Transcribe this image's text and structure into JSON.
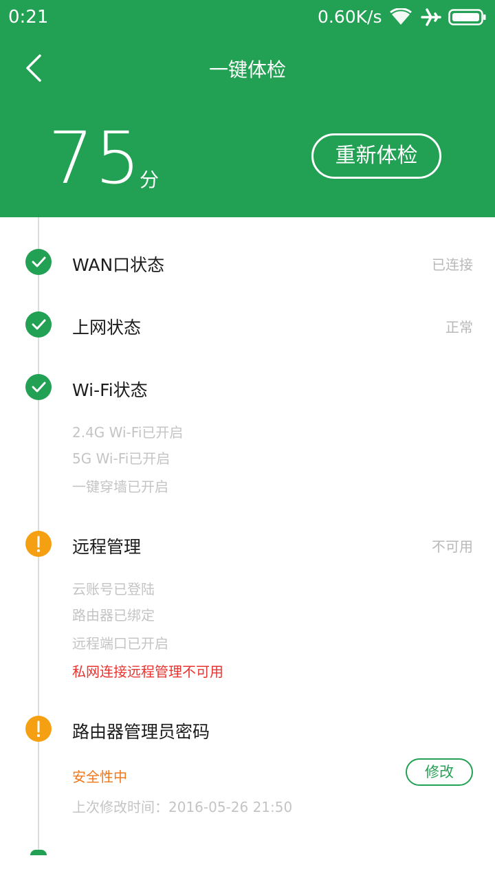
{
  "status_bar": {
    "time": "0:21",
    "net_speed": "0.60K/s",
    "icons": [
      "wifi-icon",
      "airplane-icon",
      "battery-icon"
    ]
  },
  "header": {
    "title": "一键体检",
    "score": "75",
    "score_unit": "分",
    "recheck_label": "重新体检",
    "background_color": "#22a053"
  },
  "items": [
    {
      "title": "WAN口状态",
      "status": "已连接",
      "state": "ok",
      "details": []
    },
    {
      "title": "上网状态",
      "status": "正常",
      "state": "ok",
      "details": []
    },
    {
      "title": "Wi-Fi状态",
      "status": "",
      "state": "ok",
      "details": [
        "2.4G Wi-Fi已开启",
        "5G Wi-Fi已开启",
        "一键穿墙已开启"
      ]
    },
    {
      "title": "远程管理",
      "status": "不可用",
      "state": "warn",
      "details": [
        "云账号已登陆",
        "路由器已绑定",
        "远程端口已开启",
        "私网连接远程管理不可用"
      ],
      "error_detail": "私网连接远程管理不可用"
    },
    {
      "title": "路由器管理员密码",
      "status": "",
      "state": "warn",
      "security_level": "安全性中",
      "last_modified": "上次修改时间：2016-05-26 21:50",
      "edit_label": "修改"
    }
  ],
  "colors": {
    "ok": "#22a053",
    "warn": "#f5a012",
    "error_text": "#e8332f",
    "warn_text": "#f0771a"
  }
}
